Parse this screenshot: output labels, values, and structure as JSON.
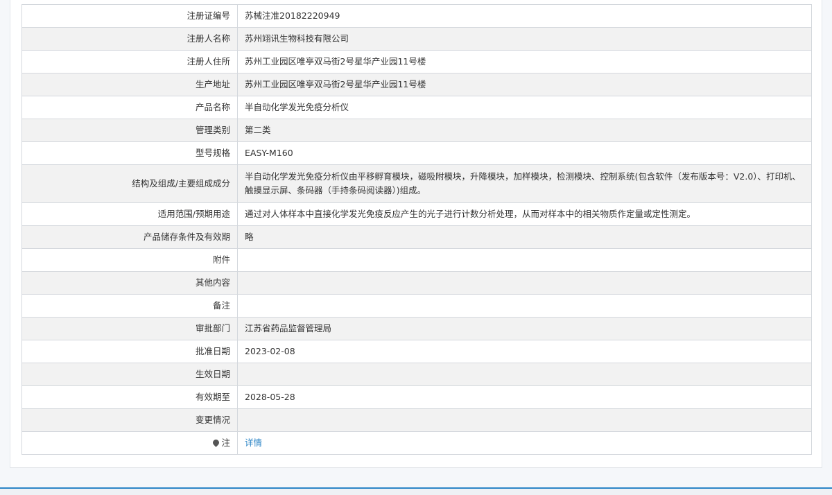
{
  "rows": [
    {
      "label": "注册证编号",
      "value": "苏械注准20182220949"
    },
    {
      "label": "注册人名称",
      "value": "苏州翊讯生物科技有限公司"
    },
    {
      "label": "注册人住所",
      "value": "苏州工业园区唯亭双马街2号星华产业园11号楼"
    },
    {
      "label": "生产地址",
      "value": "苏州工业园区唯亭双马街2号星华产业园11号楼"
    },
    {
      "label": "产品名称",
      "value": "半自动化学发光免疫分析仪"
    },
    {
      "label": "管理类别",
      "value": "第二类"
    },
    {
      "label": "型号规格",
      "value": "EASY-M160"
    },
    {
      "label": "结构及组成/主要组成成分",
      "value": "半自动化学发光免疫分析仪由平移孵育模块，磁吸附模块，升降模块，加样模块，检测模块、控制系统(包含软件（发布版本号：V2.0）、打印机、触摸显示屏、条码器（手持条码阅读器）)组成。"
    },
    {
      "label": "适用范围/预期用途",
      "value": "通过对人体样本中直接化学发光免疫反应产生的光子进行计数分析处理，从而对样本中的相关物质作定量或定性测定。"
    },
    {
      "label": "产品储存条件及有效期",
      "value": "略"
    },
    {
      "label": "附件",
      "value": ""
    },
    {
      "label": "其他内容",
      "value": ""
    },
    {
      "label": "备注",
      "value": ""
    },
    {
      "label": "审批部门",
      "value": "江苏省药品监督管理局"
    },
    {
      "label": "批准日期",
      "value": "2023-02-08"
    },
    {
      "label": "生效日期",
      "value": ""
    },
    {
      "label": "有效期至",
      "value": "2028-05-28"
    },
    {
      "label": "变更情况",
      "value": ""
    }
  ],
  "note_row": {
    "label": "注",
    "link_text": "详情",
    "icon": "map-pin-icon"
  },
  "colors": {
    "link": "#2b84c6",
    "border": "#d4d8dd",
    "stripe": "#f2f2f2"
  }
}
